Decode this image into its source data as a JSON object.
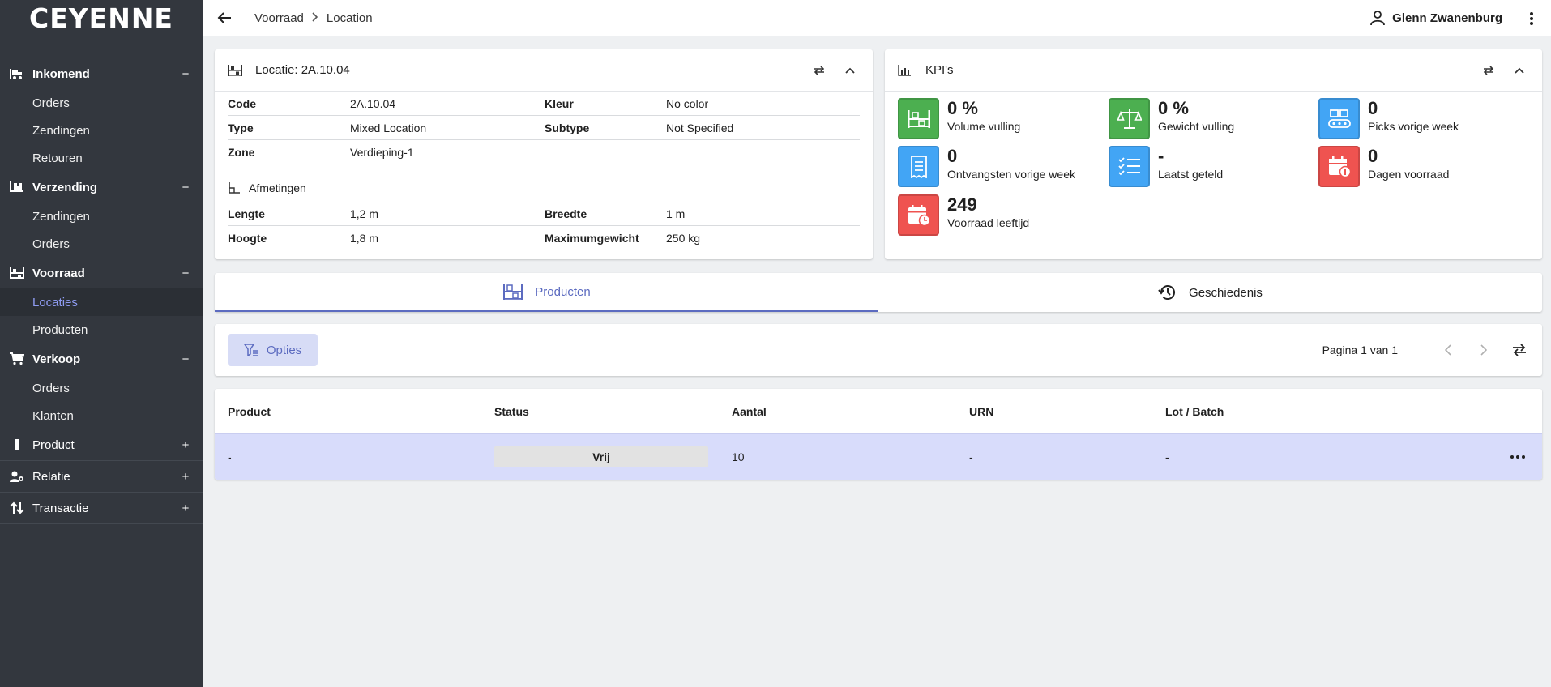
{
  "app": {
    "logo": "CEYENNE"
  },
  "sidebar": {
    "groups": [
      {
        "label": "Inkomend",
        "toggle": "−",
        "items": [
          "Orders",
          "Zendingen",
          "Retouren"
        ]
      },
      {
        "label": "Verzending",
        "toggle": "−",
        "items": [
          "Zendingen",
          "Orders"
        ]
      },
      {
        "label": "Voorraad",
        "toggle": "−",
        "items": [
          "Locaties",
          "Producten"
        ]
      },
      {
        "label": "Verkoop",
        "toggle": "−",
        "items": [
          "Orders",
          "Klanten"
        ]
      }
    ],
    "collapsed": [
      {
        "label": "Product",
        "toggle": "+"
      },
      {
        "label": "Relatie",
        "toggle": "+"
      },
      {
        "label": "Transactie",
        "toggle": "+"
      }
    ],
    "active_item": "Locaties"
  },
  "topbar": {
    "breadcrumb": [
      "Voorraad",
      "Location"
    ],
    "user": "Glenn Zwanenburg"
  },
  "location": {
    "title": "Locatie: 2A.10.04",
    "rows": [
      {
        "k": "Code",
        "v": "2A.10.04",
        "k2": "Kleur",
        "v2": "No color"
      },
      {
        "k": "Type",
        "v": "Mixed Location",
        "k2": "Subtype",
        "v2": "Not Specified"
      },
      {
        "k": "Zone",
        "v": "Verdieping-1",
        "k2": "",
        "v2": ""
      }
    ],
    "dim_title": "Afmetingen",
    "dim_rows": [
      {
        "k": "Lengte",
        "v": "1,2 m",
        "k2": "Breedte",
        "v2": "1 m"
      },
      {
        "k": "Hoogte",
        "v": "1,8 m",
        "k2": "Maximumgewicht",
        "v2": "250 kg"
      }
    ]
  },
  "kpis": {
    "title": "KPI's",
    "items": [
      {
        "value": "0 %",
        "label": "Volume vulling",
        "color": "#4caf50",
        "icon": "shelf-icon"
      },
      {
        "value": "0 %",
        "label": "Gewicht vulling",
        "color": "#4caf50",
        "icon": "scale-icon"
      },
      {
        "value": "0",
        "label": "Picks vorige week",
        "color": "#42a5f5",
        "icon": "conveyor-icon"
      },
      {
        "value": "0",
        "label": "Ontvangsten vorige week",
        "color": "#42a5f5",
        "icon": "receipt-icon"
      },
      {
        "value": "-",
        "label": "Laatst geteld",
        "color": "#42a5f5",
        "icon": "checklist-icon"
      },
      {
        "value": "0",
        "label": "Dagen voorraad",
        "color": "#ef5350",
        "icon": "calendar-alert-icon"
      },
      {
        "value": "249",
        "label": "Voorraad leeftijd",
        "color": "#ef5350",
        "icon": "calendar-clock-icon"
      }
    ]
  },
  "tabs": [
    {
      "label": "Producten",
      "active": true
    },
    {
      "label": "Geschiedenis",
      "active": false
    }
  ],
  "toolbar": {
    "options_label": "Opties",
    "pagination": "Pagina 1 van 1"
  },
  "table": {
    "columns": [
      "Product",
      "Status",
      "Aantal",
      "URN",
      "Lot / Batch"
    ],
    "rows": [
      {
        "product": "-",
        "status": "Vrij",
        "aantal": "10",
        "urn": "-",
        "lot": "-"
      }
    ]
  },
  "colors": {
    "sidebar": "#33373e",
    "accent": "#5c6bc0",
    "row_highlight": "#d8dcfb"
  }
}
